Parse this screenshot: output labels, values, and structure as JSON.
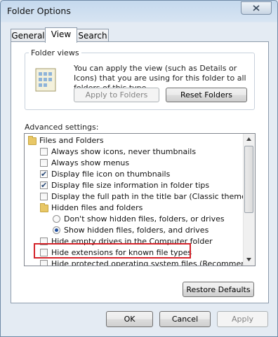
{
  "window": {
    "title": "Folder Options"
  },
  "tabs": [
    {
      "label": "General"
    },
    {
      "label": "View"
    },
    {
      "label": "Search"
    }
  ],
  "folder_views": {
    "legend": "Folder views",
    "description": "You can apply the view (such as Details or Icons) that you are using for this folder to all folders of this type.",
    "apply_label": "Apply to Folders",
    "reset_label": "Reset Folders"
  },
  "advanced": {
    "label": "Advanced settings:",
    "items": [
      {
        "label": "Files and Folders",
        "type": "folder",
        "checked": false
      },
      {
        "label": "Always show icons, never thumbnails",
        "type": "checkbox",
        "checked": false
      },
      {
        "label": "Always show menus",
        "type": "checkbox",
        "checked": false
      },
      {
        "label": "Display file icon on thumbnails",
        "type": "checkbox",
        "checked": true
      },
      {
        "label": "Display file size information in folder tips",
        "type": "checkbox",
        "checked": true
      },
      {
        "label": "Display the full path in the title bar (Classic theme only)",
        "type": "checkbox",
        "checked": false
      },
      {
        "label": "Hidden files and folders",
        "type": "folder",
        "checked": false
      },
      {
        "label": "Don't show hidden files, folders, or drives",
        "type": "radio",
        "checked": false
      },
      {
        "label": "Show hidden files, folders, and drives",
        "type": "radio",
        "checked": true
      },
      {
        "label": "Hide empty drives in the Computer folder",
        "type": "checkbox",
        "checked": false
      },
      {
        "label": "Hide extensions for known file types",
        "type": "checkbox",
        "checked": false
      },
      {
        "label": "Hide protected operating system files (Recommended)",
        "type": "checkbox",
        "checked": false
      }
    ],
    "restore_label": "Restore Defaults"
  },
  "footer": {
    "ok_label": "OK",
    "cancel_label": "Cancel",
    "apply_label": "Apply"
  },
  "colors": {
    "highlight": "#d4232a",
    "window_bg": "#dfe8f2"
  },
  "icons": [
    "close-icon",
    "folder-views-icon",
    "folder-icon",
    "scroll-up-icon",
    "scroll-down-icon"
  ]
}
